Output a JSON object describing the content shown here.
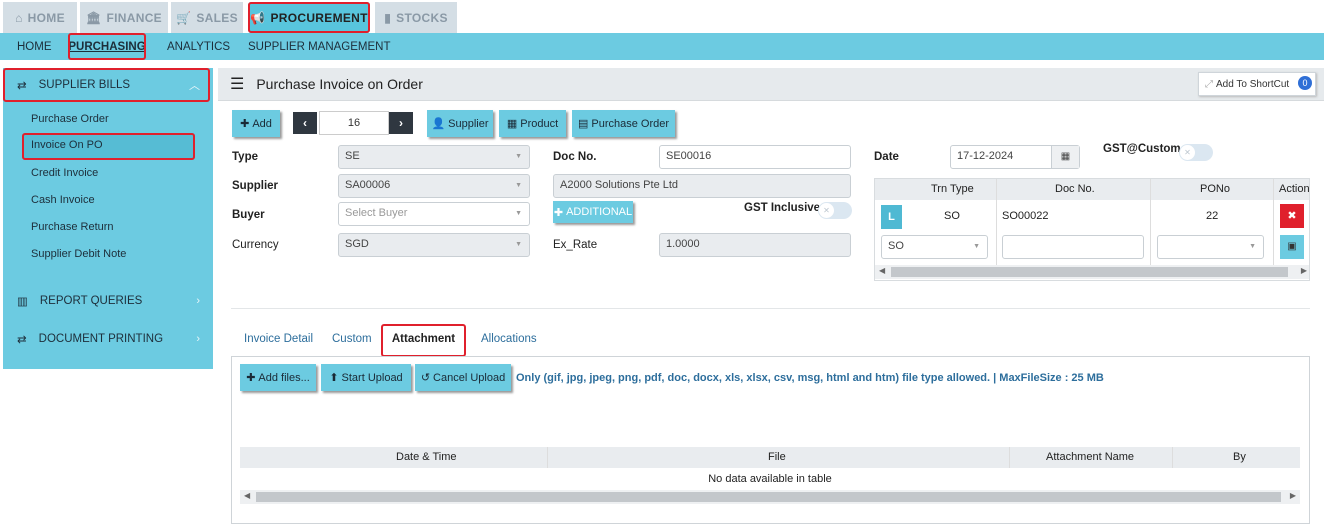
{
  "top_tabs": [
    {
      "label": "HOME",
      "icon": "home-icon"
    },
    {
      "label": "FINANCE",
      "icon": "bank-icon"
    },
    {
      "label": "SALES",
      "icon": "cart-icon"
    },
    {
      "label": "PROCUREMENT",
      "icon": "megaphone-icon"
    },
    {
      "label": "STOCKS",
      "icon": "barchart-icon"
    }
  ],
  "sub_tabs": [
    "HOME",
    "PURCHASING",
    "ANALYTICS",
    "SUPPLIER MANAGEMENT"
  ],
  "sidebar": {
    "section1": "SUPPLIER BILLS",
    "items": [
      "Purchase Order",
      "Invoice On PO",
      "Credit Invoice",
      "Cash Invoice",
      "Purchase Return",
      "Supplier Debit Note"
    ],
    "section2": "REPORT QUERIES",
    "section3": "DOCUMENT PRINTING"
  },
  "page": {
    "title": "Purchase Invoice on Order",
    "shortcut_label": "Add To ShortCut",
    "shortcut_count": "0"
  },
  "toolbar": {
    "add": "Add",
    "page_no": "16",
    "supplier": "Supplier",
    "product": "Product",
    "purchase_order": "Purchase Order"
  },
  "form": {
    "type_label": "Type",
    "type_value": "SE",
    "supplier_label": "Supplier",
    "supplier_value": "SA00006",
    "buyer_label": "Buyer",
    "buyer_placeholder": "Select Buyer",
    "currency_label": "Currency",
    "currency_value": "SGD",
    "docno_label": "Doc No.",
    "docno_value": "SE00016",
    "supplier_name": "A2000 Solutions Pte Ltd",
    "additional": "ADDITIONAL",
    "gst_inclusive": "GST Inclusive",
    "exrate_label": "Ex_Rate",
    "exrate_value": "1.0000",
    "date_label": "Date",
    "date_value": "17-12-2024",
    "gst_custom": "GST@Custom"
  },
  "trn_table": {
    "headers": [
      "Trn Type",
      "Doc No.",
      "PONo",
      "Action"
    ],
    "row_tag": "L",
    "row": {
      "trn_type": "SO",
      "doc_no": "SO00022",
      "pono": "22"
    },
    "new_row_type": "SO"
  },
  "tabs": [
    "Invoice Detail",
    "Custom",
    "Attachment",
    "Allocations"
  ],
  "attachment": {
    "add_files": "Add files...",
    "start_upload": "Start Upload",
    "cancel_upload": "Cancel Upload",
    "note": "Only (gif, jpg, jpeg, png, pdf, doc, docx, xls, xlsx, csv, msg, html and htm) file type allowed. | MaxFileSize : 25 MB",
    "headers": [
      "Date & Time",
      "File",
      "Attachment Name",
      "By"
    ],
    "empty": "No data available in table"
  }
}
